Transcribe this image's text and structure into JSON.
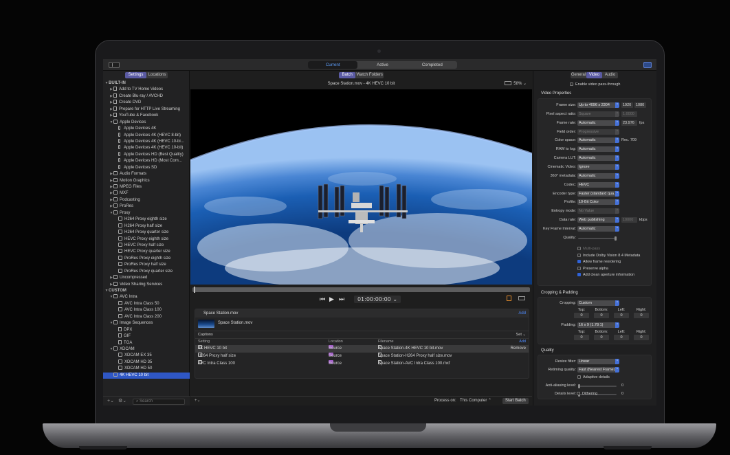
{
  "topbar": {
    "tabs": [
      "Current",
      "Active",
      "Completed"
    ],
    "active_tab": "Current"
  },
  "sidebar": {
    "tabs": [
      "Settings",
      "Locations"
    ],
    "search_placeholder": "Search",
    "tree": [
      {
        "label": "BUILT-IN",
        "level": 0,
        "group": true
      },
      {
        "label": "Add to TV Home Videos",
        "level": 1,
        "twisty": "▶",
        "icon": "doc"
      },
      {
        "label": "Create Blu-ray / AVCHD",
        "level": 1,
        "twisty": "▶",
        "icon": "doc"
      },
      {
        "label": "Create DVD",
        "level": 1,
        "twisty": "▶",
        "icon": "doc"
      },
      {
        "label": "Prepare for HTTP Live Streaming",
        "level": 1,
        "twisty": "▶",
        "icon": "doc"
      },
      {
        "label": "YouTube & Facebook",
        "level": 1,
        "twisty": "▶",
        "icon": "doc"
      },
      {
        "label": "Apple Devices",
        "level": 1,
        "twisty": "▼",
        "icon": "gear"
      },
      {
        "label": "Apple Devices 4K",
        "level": 2,
        "icon": "phone"
      },
      {
        "label": "Apple Devices 4K (HEVC 8-bit)",
        "level": 2,
        "icon": "phone"
      },
      {
        "label": "Apple Devices 4K (HEVC 10-bi...",
        "level": 2,
        "icon": "phone"
      },
      {
        "label": "Apple Devices 4K (HEVC 10-bit)",
        "level": 2,
        "icon": "phone"
      },
      {
        "label": "Apple Devices HD (Best Quality)",
        "level": 2,
        "icon": "phone"
      },
      {
        "label": "Apple Devices HD (Most Com...",
        "level": 2,
        "icon": "phone"
      },
      {
        "label": "Apple Devices SD",
        "level": 2,
        "icon": "phone"
      },
      {
        "label": "Audio Formats",
        "level": 1,
        "twisty": "▶",
        "icon": "gear"
      },
      {
        "label": "Motion Graphics",
        "level": 1,
        "twisty": "▶",
        "icon": "gear"
      },
      {
        "label": "MPEG Files",
        "level": 1,
        "twisty": "▶",
        "icon": "gear"
      },
      {
        "label": "MXF",
        "level": 1,
        "twisty": "▶",
        "icon": "gear"
      },
      {
        "label": "Podcasting",
        "level": 1,
        "twisty": "▶",
        "icon": "gear"
      },
      {
        "label": "ProRes",
        "level": 1,
        "twisty": "▶",
        "icon": "gear"
      },
      {
        "label": "Proxy",
        "level": 1,
        "twisty": "▼",
        "icon": "gear"
      },
      {
        "label": "H264 Proxy eighth size",
        "level": 2,
        "icon": "gear"
      },
      {
        "label": "H264 Proxy half size",
        "level": 2,
        "icon": "gear"
      },
      {
        "label": "H264 Proxy quarter size",
        "level": 2,
        "icon": "gear"
      },
      {
        "label": "HEVC Proxy eighth size",
        "level": 2,
        "icon": "gear"
      },
      {
        "label": "HEVC Proxy half size",
        "level": 2,
        "icon": "gear"
      },
      {
        "label": "HEVC Proxy quarter size",
        "level": 2,
        "icon": "gear"
      },
      {
        "label": "ProRes Proxy eighth size",
        "level": 2,
        "icon": "gear"
      },
      {
        "label": "ProRes Proxy half size",
        "level": 2,
        "icon": "gear"
      },
      {
        "label": "ProRes Proxy quarter size",
        "level": 2,
        "icon": "gear"
      },
      {
        "label": "Uncompressed",
        "level": 1,
        "twisty": "▶",
        "icon": "gear"
      },
      {
        "label": "Video Sharing Services",
        "level": 1,
        "twisty": "▶",
        "icon": "gear"
      },
      {
        "label": "CUSTOM",
        "level": 0,
        "group": true
      },
      {
        "label": "AVC Intra",
        "level": 1,
        "twisty": "▼",
        "icon": "gear"
      },
      {
        "label": "AVC Intra Class 50",
        "level": 2,
        "icon": "film"
      },
      {
        "label": "AVC Intra Class 100",
        "level": 2,
        "icon": "film"
      },
      {
        "label": "AVC Intra Class 200",
        "level": 2,
        "icon": "film"
      },
      {
        "label": "Image Sequences",
        "level": 1,
        "twisty": "▼",
        "icon": "gear"
      },
      {
        "label": "DPX",
        "level": 2,
        "icon": "doc"
      },
      {
        "label": "GIF",
        "level": 2,
        "icon": "doc"
      },
      {
        "label": "TGA",
        "level": 2,
        "icon": "doc"
      },
      {
        "label": "XDCAM",
        "level": 1,
        "twisty": "▼",
        "icon": "gear"
      },
      {
        "label": "XDCAM EX 35",
        "level": 2,
        "icon": "film"
      },
      {
        "label": "XDCAM HD 35",
        "level": 2,
        "icon": "film"
      },
      {
        "label": "XDCAM HD 50",
        "level": 2,
        "icon": "film"
      },
      {
        "label": "4K HEVC 10 bit",
        "level": 1,
        "icon": "gear",
        "selected": true
      }
    ]
  },
  "center": {
    "tabs": [
      "Batch",
      "Watch Folders"
    ],
    "file_title": "Space Station.mov - 4K HEVC 10 bit",
    "zoom": "58%",
    "timecode": "01:00:00:00",
    "batch": {
      "header": "Space Station.mov",
      "add": "Add",
      "file_name": "Space Station.mov",
      "captions": "Captions",
      "set": "Set",
      "columns": [
        "Setting",
        "Location",
        "Filename"
      ],
      "col_add": "Add",
      "remove": "Remove",
      "rows": [
        {
          "setting": "4K HEVC 10 bit",
          "location": "Source",
          "filename": "Space Station-4K HEVC 10 bit.mov"
        },
        {
          "setting": "H264 Proxy half size",
          "location": "Source",
          "filename": "Space Station-H264 Proxy half size.mov"
        },
        {
          "setting": "AVC Intra Class 100",
          "location": "Source",
          "filename": "Space Station-AVC Intra Class 100.mxf"
        }
      ]
    },
    "footer": {
      "process_label": "Process on:",
      "process_value": "This Computer",
      "start": "Start Batch"
    }
  },
  "inspector": {
    "tabs": [
      "General",
      "Video",
      "Audio"
    ],
    "passthrough": "Enable video pass-through",
    "video_title": "Video Properties",
    "props": [
      {
        "label": "Frame size:",
        "value": "Up to 4096 x 2304",
        "f1": "1920",
        "f2": "1080"
      },
      {
        "label": "Pixel aspect ratio:",
        "value": "Square",
        "dim": true,
        "f1": "1.0000",
        "f1dim": true
      },
      {
        "label": "Frame rate:",
        "value": "Automatic",
        "f1": "23.976",
        "extra": "fps"
      },
      {
        "label": "Field order:",
        "value": "Progressive",
        "dim": true
      },
      {
        "label": "Color space:",
        "value": "Automatic",
        "extra": "Rec. 709"
      },
      {
        "label": "RAW to log:",
        "value": "Automatic"
      },
      {
        "label": "Camera LUT:",
        "value": "Automatic"
      },
      {
        "label": "Cinematic Video:",
        "value": "Ignore"
      },
      {
        "label": "360° metadata:",
        "value": "Automatic"
      },
      {
        "label": "Codec:",
        "value": "HEVC"
      },
      {
        "label": "Encoder type:",
        "value": "Faster (standard qua..."
      },
      {
        "label": "Profile:",
        "value": "10-Bit Color"
      },
      {
        "label": "Entropy mode:",
        "value": "No Value",
        "dim": true
      },
      {
        "label": "Data rate:",
        "value": "Web publishing",
        "f1": "10000",
        "f1dim": true,
        "extra": "kbps"
      },
      {
        "label": "Key Frame Interval:",
        "value": "Automatic"
      }
    ],
    "quality_label": "Quality:",
    "checks": [
      {
        "label": "Multi-pass",
        "on": false,
        "dim": true
      },
      {
        "label": "Include Dolby Vision 8.4 Metadata",
        "on": false
      },
      {
        "label": "Allow frame reordering",
        "on": true
      },
      {
        "label": "Preserve alpha",
        "on": false
      },
      {
        "label": "Add clean aperture information",
        "on": true
      }
    ],
    "crop_title": "Cropping & Padding",
    "cropping_label": "Cropping:",
    "cropping_value": "Custom",
    "padding_label": "Padding:",
    "padding_value": "16 x 9 (1.78:1)",
    "edges": [
      "Top:",
      "Bottom:",
      "Left:",
      "Right:"
    ],
    "edge_value": "0",
    "quality_title": "Quality",
    "resize_label": "Resize filter:",
    "resize_value": "Linear",
    "retiming_label": "Retiming quality:",
    "retiming_value": "Fast (Nearest Frame)",
    "adaptive": "Adaptive details",
    "antialias_label": "Anti-aliasing level:",
    "antialias_value": "0",
    "details_label": "Details level:",
    "details_value": "0",
    "dithering": "Dithering"
  }
}
